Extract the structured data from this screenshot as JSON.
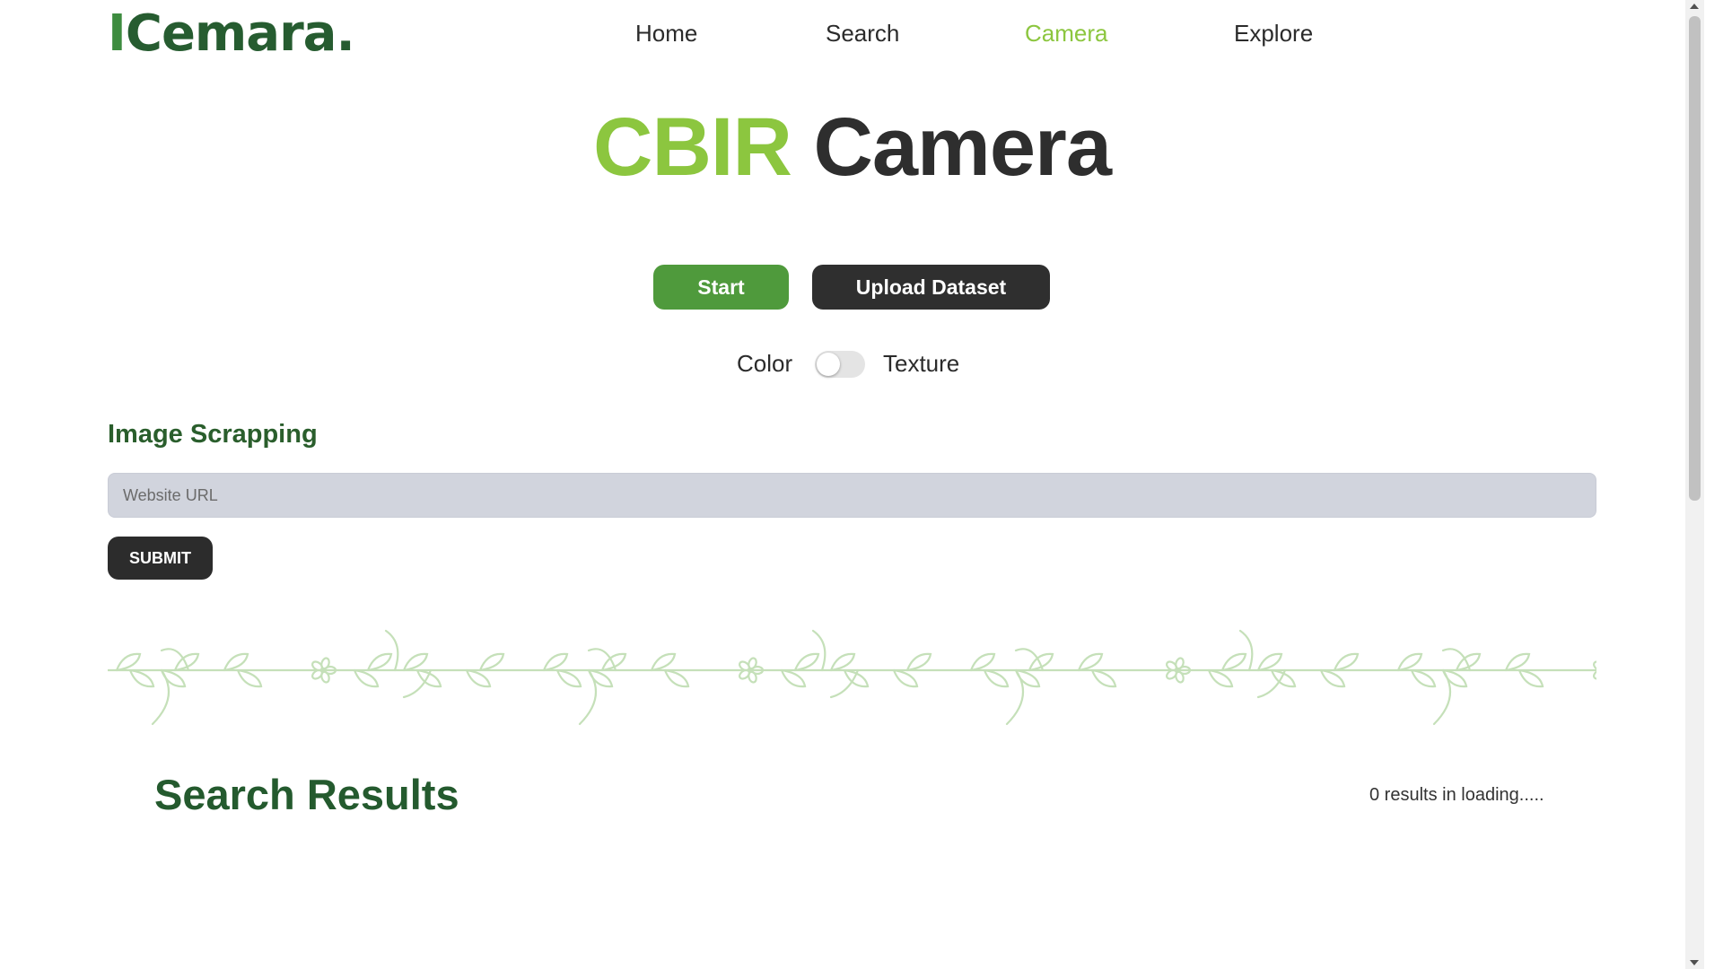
{
  "header": {
    "logo_initial": "I",
    "logo_text": "Cemara",
    "logo_dot": ".",
    "nav": [
      {
        "label": "Home",
        "active": false
      },
      {
        "label": "Search",
        "active": false
      },
      {
        "label": "Camera",
        "active": true
      },
      {
        "label": "Explore",
        "active": false
      }
    ]
  },
  "title": {
    "accent": "CBIR",
    "main": "Camera"
  },
  "actions": {
    "start_label": "Start",
    "upload_label": "Upload Dataset"
  },
  "toggle": {
    "left_label": "Color",
    "right_label": "Texture",
    "checked": false
  },
  "scrapping": {
    "title": "Image Scrapping",
    "placeholder": "Website URL",
    "value": "",
    "submit_label": "SUBMIT"
  },
  "results": {
    "title": "Search Results",
    "count_text": "0 results in loading....."
  },
  "colors": {
    "accent_green": "#8cc63f",
    "dark_green": "#265c30",
    "start_button": "#4f9a3c",
    "dark_button": "#2f2f2f",
    "vine": "#c5e0b9"
  },
  "icons": {
    "toggle": "toggle-switch",
    "decoration": "leaf-vine-divider"
  }
}
